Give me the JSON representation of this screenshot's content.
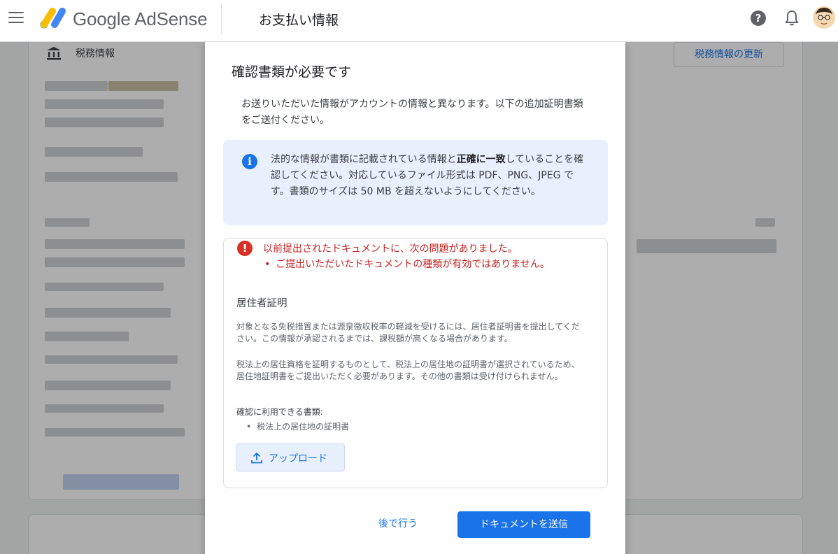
{
  "header": {
    "app_name": "Google AdSense",
    "page_title": "お支払い情報"
  },
  "background": {
    "tax_label": "税務情報",
    "tax_update_button": "税務情報の更新"
  },
  "dialog": {
    "title": "確認書類が必要です",
    "description": "お送りいただいた情報がアカウントの情報と異なります。以下の追加証明書類をご送付ください。",
    "info": {
      "text_before": "法的な情報が書類に記載されている情報と",
      "text_bold": "正確に一致",
      "text_after": "していることを確認してください。対応しているファイル形式は PDF、PNG、JPEG です。書類のサイズは 50 MB を超えないようにしてください。"
    },
    "error": {
      "title": "以前提出されたドキュメントに、次の問題がありました。",
      "item": "ご提出いただいたドキュメントの種類が有効ではありません。"
    },
    "section": {
      "title": "居住者証明",
      "para1": "対象となる免税措置または源泉徴収税率の軽減を受けるには、居住者証明書を提出してください。この情報が承認されるまでは、課税額が高くなる場合があります。",
      "para2": "税法上の居住資格を証明するものとして、税法上の居住地の証明書が選択されているため、居住地証明書をご提出いただく必要があります。その他の書類は受け付けられません。",
      "docs_label": "確認に利用できる書類:",
      "docs_item": "税法上の居住地の証明書",
      "upload_label": "アップロード"
    },
    "buttons": {
      "later": "後で行う",
      "submit": "ドキュメントを送信"
    }
  }
}
